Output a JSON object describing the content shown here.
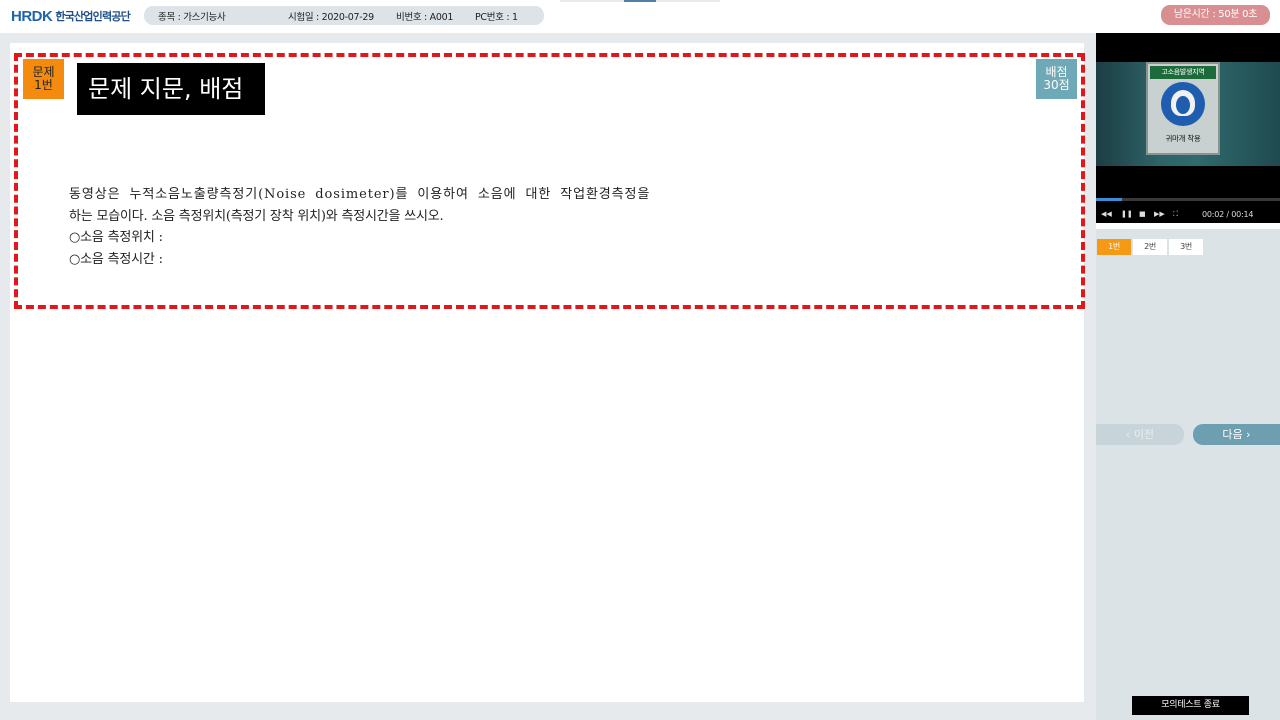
{
  "header": {
    "logo_brand": "HRDK",
    "logo_org": "한국산업인력공단",
    "subject": "종목 : 가스기능사",
    "exam_date": "시험일 : 2020-07-29",
    "seat_number": "비번호 : A001",
    "pc_number": "PC번호 : 1",
    "timer": "남은시간 : 50분 0초"
  },
  "question": {
    "number_line1": "문제",
    "number_line2": "1번",
    "points_line1": "배점",
    "points_line2": "30점",
    "overlay_label": "문제 지문, 배점",
    "text_lines": [
      "동영상은 누적소음노출량측정기(Noise dosimeter)를 이용하여 소음에 대한 작업환경측정을",
      "하는 모습이다. 소음 측정위치(측정기 장착 위치)와 측정시간을 쓰시오.",
      "○소음 측정위치 :",
      "○소음 측정시간 :"
    ]
  },
  "video": {
    "sign_top": "고소음발생지역",
    "sign_bottom": "귀마개 착용",
    "time": "00:02 / 00:14",
    "progress": 0.14
  },
  "question_tabs": [
    {
      "label": "1번",
      "active": true
    },
    {
      "label": "2번",
      "active": false
    },
    {
      "label": "3번",
      "active": false
    }
  ],
  "nav": {
    "prev_label": "‹ 이전",
    "next_label": "다음 ›",
    "end_label": "모의테스트 종료"
  },
  "colors": {
    "accent_orange": "#f48b0f",
    "points_teal": "#6fa8b6",
    "timer_pink": "#d98f91",
    "dashed_red": "#e0171b"
  }
}
